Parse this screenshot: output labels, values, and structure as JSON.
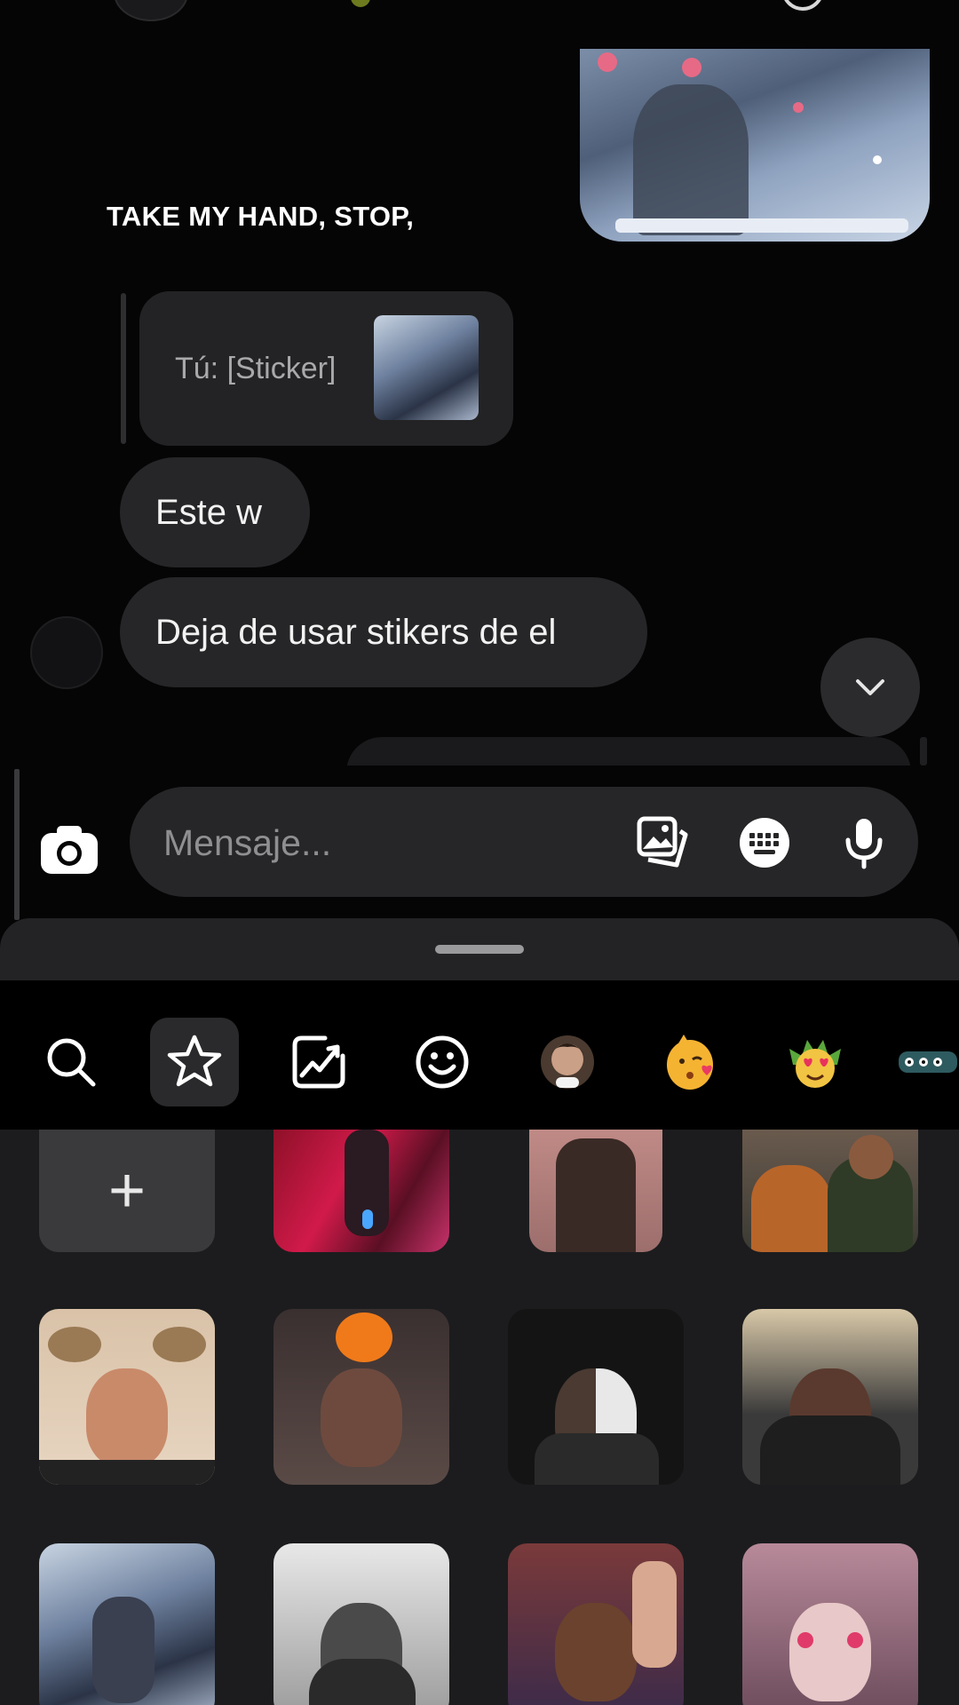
{
  "chat": {
    "lyric_text": "TAKE MY HAND, STOP,",
    "reply": {
      "text": "Tú: [Sticker]"
    },
    "messages": [
      {
        "text": "Este w"
      },
      {
        "text": "Deja de usar stikers de el"
      }
    ]
  },
  "composer": {
    "placeholder": "Mensaje..."
  },
  "sticker_tray": {
    "tabs": [
      {
        "icon": "search-icon"
      },
      {
        "icon": "star-icon",
        "active": true
      },
      {
        "icon": "trending-icon"
      },
      {
        "icon": "smiley-icon"
      },
      {
        "icon": "avatar-sticker-icon"
      },
      {
        "icon": "kiss-emoji-icon"
      },
      {
        "icon": "heart-eyes-emoji-icon"
      },
      {
        "icon": "more-sticker-icon"
      }
    ],
    "add_label": "+"
  },
  "colors": {
    "background": "#050506",
    "bubble": "#262628",
    "sheet": "#1c1c1e",
    "accent_active_tab": "#2a2a2c"
  }
}
